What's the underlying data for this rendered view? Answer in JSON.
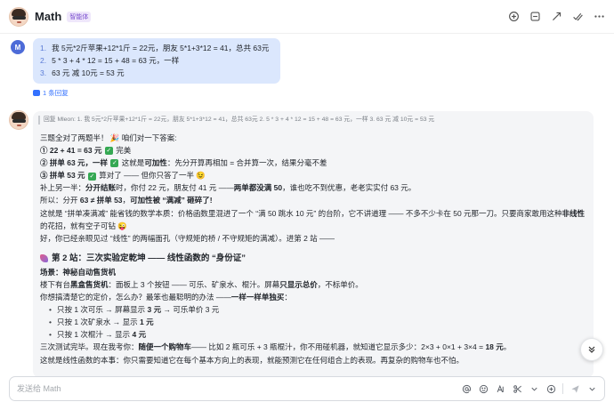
{
  "header": {
    "title": "Math",
    "badge": "智能体"
  },
  "user_message": {
    "avatar_letter": "M",
    "items": [
      {
        "num": "1.",
        "text": "我 5元*2斤苹果+12*1斤 = 22元，朋友 5*1+3*12 = 41，总共 63元"
      },
      {
        "num": "2.",
        "text": "5 * 3 + 4 * 12 = 15 + 48 = 63 元，一样"
      },
      {
        "num": "3.",
        "text": "63 元 减 10元 = 53 元"
      }
    ],
    "reply_count": "1 条回复"
  },
  "bot_message": {
    "quote": "回复 Mleon:  1. 我 5元*2斤苹果+12*1斤 = 22元，朋友 5*1+3*12 = 41，总共 63元 2. 5 * 3 + 4 * 12 = 15 + 48 = 63 元，一样 3. 63 元 减 10元 = 53 元",
    "intro": "三题全对了两题半！ 🎉 咱们对一下答案:",
    "a1_bold": "① 22 + 41 = 63 元",
    "a1_rest": "完美",
    "a2_bold": "② 拼单 63 元，一样",
    "a2_mid": "这就是",
    "a2_bold2": "可加性",
    "a2_rest": "：先分开算再相加 = 合并算一次，结果分毫不差",
    "a3_bold": "③ 拼单 53 元",
    "a3_rest": "算对了 —— 但你只答了一半 😉",
    "supp_pre": "补上另一半：",
    "supp_bold": "分开结账",
    "supp_mid": "时，你付 22 元，朋友付 41 元 ——",
    "supp_bold2": "两单都没满 50",
    "supp_rest": "，谁也吃不到优惠，老老实实付 63 元。",
    "so_pre": "所以：分开 ",
    "so_b1": "63 ≠ 拼单 53",
    "so_mid": "，",
    "so_b2": "可加性被 “满减” 砸碎了!",
    "long_text": "这就是 “拼单凑满减” 能省钱的数学本质：价格函数里混进了一个 “满 50 跳水 10 元” 的台阶，它不讲道理 —— 不多不少卡在 50 元那一刀。只要商家敢用这种",
    "long_bold": "非线性",
    "long_end": "的花招，就有空子可钻 😜",
    "transition": "好，你已经亲眼见过 “线性” 的两幅面孔（守规矩的桥 / 不守规矩的满减）。进第 2 站 ——",
    "station_title": "第 2 站：三次实验定乾坤 —— 线性函数的 “身份证”",
    "scene_label": "场景：",
    "scene_bold": "神秘自动售货机",
    "desc_pre": "楼下有台",
    "desc_bold": "黑盒售货机",
    "desc_mid": "：面板上 3 个按钮 —— 可乐、矿泉水、棍汁。屏幕",
    "desc_bold2": "只显示总价",
    "desc_end": "，不标单价。",
    "q_pre": "你想搞清楚它的定价，怎么办？最笨也最聪明的办法 ——",
    "q_bold": "一样一样单独买",
    "q_end": "：",
    "bullets": [
      {
        "pre": "只按 1 次可乐 → 屏幕显示 ",
        "bold": "3 元",
        "post": " → 可乐单价 3 元"
      },
      {
        "pre": "只按 1 次矿泉水 → 显示 ",
        "bold": "1 元",
        "post": ""
      },
      {
        "pre": "只按 1 次棍汁 → 显示 ",
        "bold": "4 元",
        "post": ""
      }
    ],
    "final_pre": "三次测试完毕。现在我考你：",
    "final_bold": "随便一个购物车",
    "final_mid": "—— 比如 2 瓶可乐 + 3 瓶棍汁，你不用碰机器，就知道它显示多少：2×3 + 0×1 + 3×4 = ",
    "final_bold2": "18 元",
    "final_end": "。",
    "cut_line": "这就是线性函数的本事：你只需要知道它在每个基本方向上的表现，就能预测它在任何组合上的表现。再复杂的购物车也不怕。"
  },
  "composer": {
    "placeholder": "发送给 Math"
  },
  "icons": {
    "accent": "#3371ff",
    "check_green": "#35a853",
    "bubble_bg": "#dbe7fd",
    "card_bg": "#f4f5f7"
  }
}
